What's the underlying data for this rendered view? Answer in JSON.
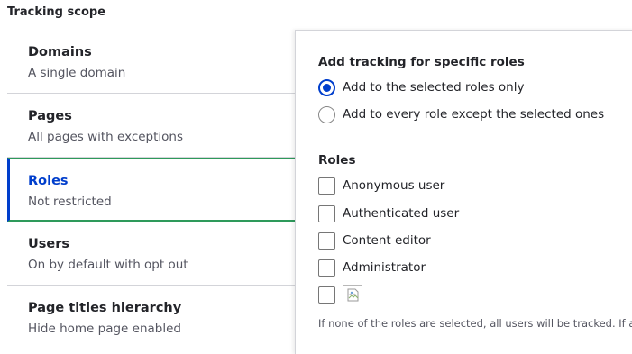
{
  "fieldset": {
    "legend": "Tracking scope"
  },
  "tabs": [
    {
      "title": "Domains",
      "summary": "A single domain",
      "active": false
    },
    {
      "title": "Pages",
      "summary": "All pages with exceptions",
      "active": false
    },
    {
      "title": "Roles",
      "summary": "Not restricted",
      "active": true
    },
    {
      "title": "Users",
      "summary": "On by default with opt out",
      "active": false
    },
    {
      "title": "Page titles hierarchy",
      "summary": "Hide home page enabled",
      "active": false
    }
  ],
  "pane": {
    "specific_roles": {
      "label": "Add tracking for specific roles",
      "options": [
        {
          "label": "Add to the selected roles only",
          "checked": true
        },
        {
          "label": "Add to every role except the selected ones",
          "checked": false
        }
      ]
    },
    "roles": {
      "label": "Roles",
      "options": [
        {
          "label": "Anonymous user",
          "checked": false
        },
        {
          "label": "Authenticated user",
          "checked": false
        },
        {
          "label": "Content editor",
          "checked": false
        },
        {
          "label": "Administrator",
          "checked": false
        },
        {
          "label": "",
          "checked": false,
          "broken_image": true
        }
      ]
    },
    "description": "If none of the roles are selected, all users will be tracked. If a"
  },
  "colors": {
    "accent": "#003ecc",
    "active_outline": "#2e9a5b",
    "text": "#232429",
    "muted": "#545560",
    "border": "#d3d4d9"
  }
}
